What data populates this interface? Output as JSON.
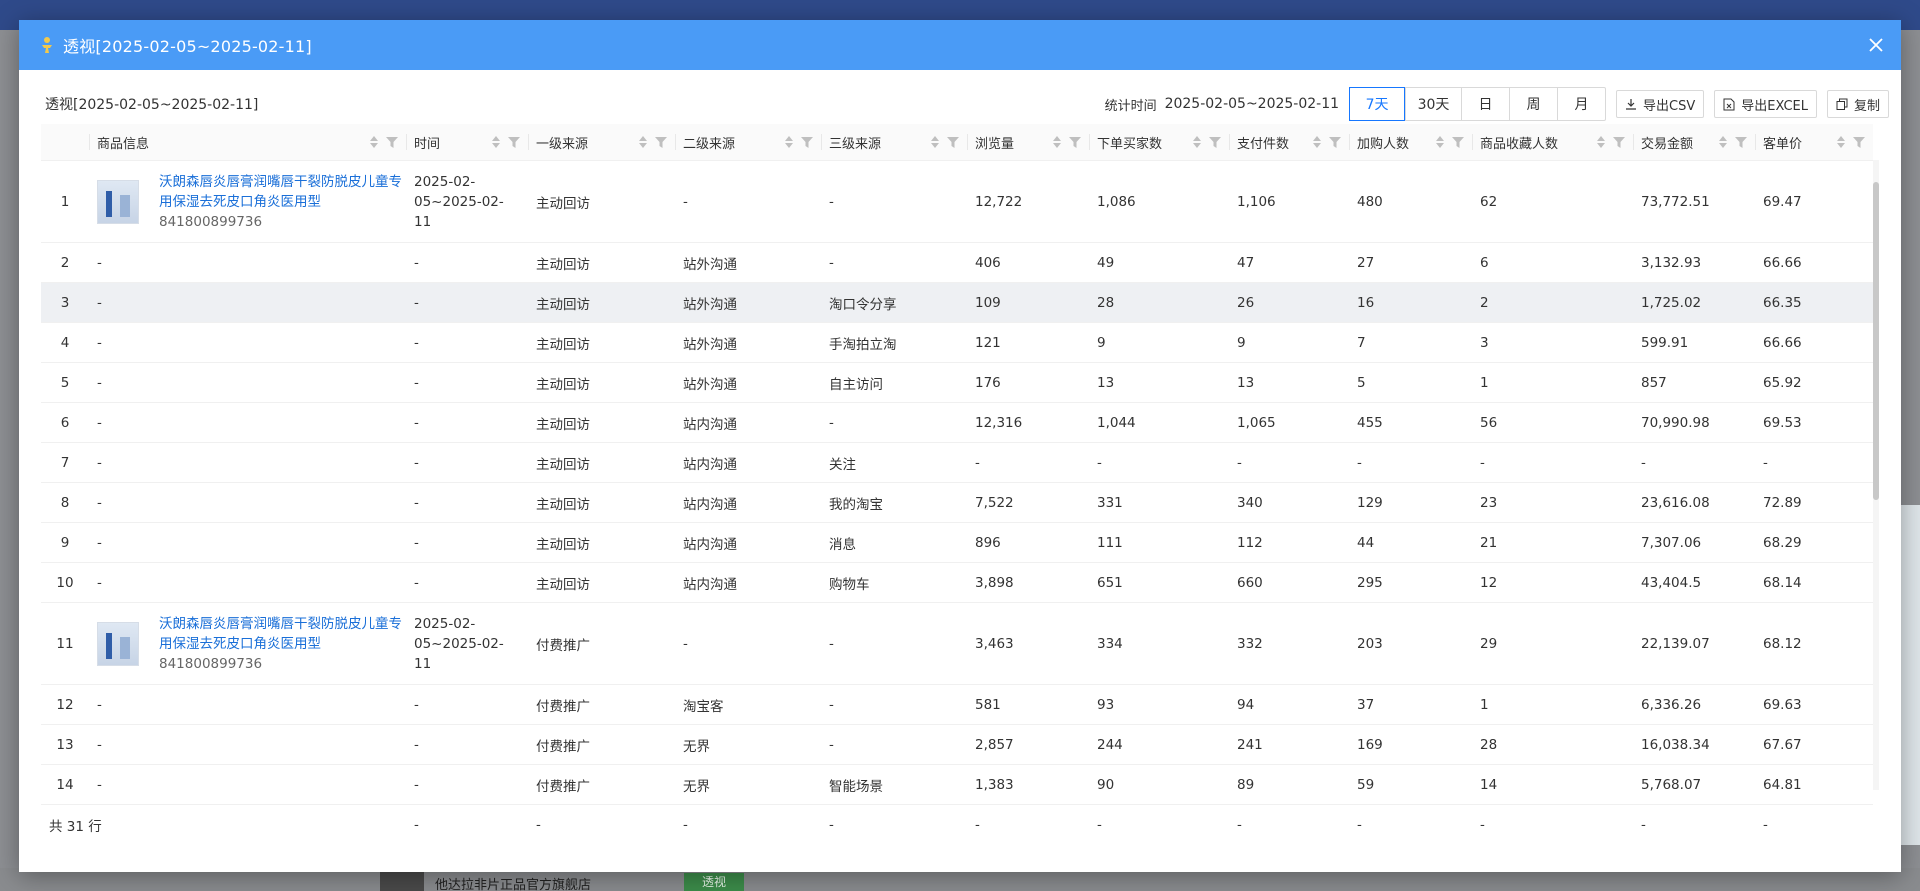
{
  "modal": {
    "title": "透视[2025-02-05~2025-02-11]",
    "subtitle": "透视[2025-02-05~2025-02-11]"
  },
  "toolbar": {
    "stat_label": "统计时间",
    "stat_range": "2025-02-05~2025-02-11",
    "periods": [
      "7天",
      "30天",
      "日",
      "周",
      "月"
    ],
    "active_period": "7天",
    "export_csv": "导出CSV",
    "export_excel": "导出EXCEL",
    "copy": "复制"
  },
  "table": {
    "columns": [
      "",
      "商品信息",
      "时间",
      "一级来源",
      "二级来源",
      "三级来源",
      "浏览量",
      "下单买家数",
      "支付件数",
      "加购人数",
      "商品收藏人数",
      "交易金额",
      "客单价"
    ],
    "rows": [
      {
        "idx": "1",
        "product_name": "沃朗森唇炎唇膏润嘴唇干裂防脱皮儿童专用保湿去死皮口角炎医用型",
        "product_id": "841800899736",
        "time": "2025-02-05~2025-02-11",
        "src1": "主动回访",
        "src2": "-",
        "src3": "-",
        "pv": "12,722",
        "buyers": "1,086",
        "paid": "1,106",
        "cart": "480",
        "fav": "62",
        "amount": "73,772.51",
        "aov": "69.47"
      },
      {
        "idx": "2",
        "product_name": "-",
        "time": "-",
        "src1": "主动回访",
        "src2": "站外沟通",
        "src3": "-",
        "pv": "406",
        "buyers": "49",
        "paid": "47",
        "cart": "27",
        "fav": "6",
        "amount": "3,132.93",
        "aov": "66.66"
      },
      {
        "idx": "3",
        "product_name": "-",
        "time": "-",
        "src1": "主动回访",
        "src2": "站外沟通",
        "src3": "淘口令分享",
        "pv": "109",
        "buyers": "28",
        "paid": "26",
        "cart": "16",
        "fav": "2",
        "amount": "1,725.02",
        "aov": "66.35"
      },
      {
        "idx": "4",
        "product_name": "-",
        "time": "-",
        "src1": "主动回访",
        "src2": "站外沟通",
        "src3": "手淘拍立淘",
        "pv": "121",
        "buyers": "9",
        "paid": "9",
        "cart": "7",
        "fav": "3",
        "amount": "599.91",
        "aov": "66.66"
      },
      {
        "idx": "5",
        "product_name": "-",
        "time": "-",
        "src1": "主动回访",
        "src2": "站外沟通",
        "src3": "自主访问",
        "pv": "176",
        "buyers": "13",
        "paid": "13",
        "cart": "5",
        "fav": "1",
        "amount": "857",
        "aov": "65.92"
      },
      {
        "idx": "6",
        "product_name": "-",
        "time": "-",
        "src1": "主动回访",
        "src2": "站内沟通",
        "src3": "-",
        "pv": "12,316",
        "buyers": "1,044",
        "paid": "1,065",
        "cart": "455",
        "fav": "56",
        "amount": "70,990.98",
        "aov": "69.53"
      },
      {
        "idx": "7",
        "product_name": "-",
        "time": "-",
        "src1": "主动回访",
        "src2": "站内沟通",
        "src3": "关注",
        "pv": "-",
        "buyers": "-",
        "paid": "-",
        "cart": "-",
        "fav": "-",
        "amount": "-",
        "aov": "-"
      },
      {
        "idx": "8",
        "product_name": "-",
        "time": "-",
        "src1": "主动回访",
        "src2": "站内沟通",
        "src3": "我的淘宝",
        "pv": "7,522",
        "buyers": "331",
        "paid": "340",
        "cart": "129",
        "fav": "23",
        "amount": "23,616.08",
        "aov": "72.89"
      },
      {
        "idx": "9",
        "product_name": "-",
        "time": "-",
        "src1": "主动回访",
        "src2": "站内沟通",
        "src3": "消息",
        "pv": "896",
        "buyers": "111",
        "paid": "112",
        "cart": "44",
        "fav": "21",
        "amount": "7,307.06",
        "aov": "68.29"
      },
      {
        "idx": "10",
        "product_name": "-",
        "time": "-",
        "src1": "主动回访",
        "src2": "站内沟通",
        "src3": "购物车",
        "pv": "3,898",
        "buyers": "651",
        "paid": "660",
        "cart": "295",
        "fav": "12",
        "amount": "43,404.5",
        "aov": "68.14"
      },
      {
        "idx": "11",
        "product_name": "沃朗森唇炎唇膏润嘴唇干裂防脱皮儿童专用保湿去死皮口角炎医用型",
        "product_id": "841800899736",
        "time": "2025-02-05~2025-02-11",
        "src1": "付费推广",
        "src2": "-",
        "src3": "-",
        "pv": "3,463",
        "buyers": "334",
        "paid": "332",
        "cart": "203",
        "fav": "29",
        "amount": "22,139.07",
        "aov": "68.12"
      },
      {
        "idx": "12",
        "product_name": "-",
        "time": "-",
        "src1": "付费推广",
        "src2": "淘宝客",
        "src3": "-",
        "pv": "581",
        "buyers": "93",
        "paid": "94",
        "cart": "37",
        "fav": "1",
        "amount": "6,336.26",
        "aov": "69.63"
      },
      {
        "idx": "13",
        "product_name": "-",
        "time": "-",
        "src1": "付费推广",
        "src2": "无界",
        "src3": "-",
        "pv": "2,857",
        "buyers": "244",
        "paid": "241",
        "cart": "169",
        "fav": "28",
        "amount": "16,038.34",
        "aov": "67.67"
      },
      {
        "idx": "14",
        "product_name": "-",
        "time": "-",
        "src1": "付费推广",
        "src2": "无界",
        "src3": "智能场景",
        "pv": "1,383",
        "buyers": "90",
        "paid": "89",
        "cart": "59",
        "fav": "14",
        "amount": "5,768.07",
        "aov": "64.81"
      }
    ],
    "footer": {
      "total": "共 31 行",
      "dash": "-"
    }
  },
  "background": {
    "shop_name": "他达拉非片正品官方旗舰店",
    "badge": "透视"
  }
}
